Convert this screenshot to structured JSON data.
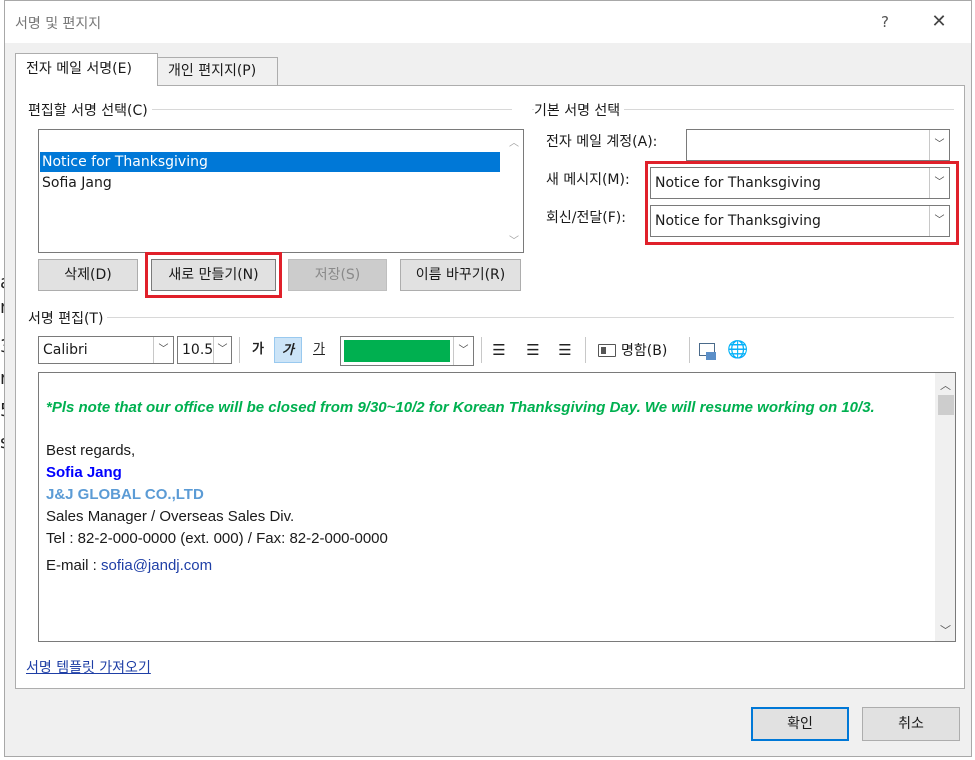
{
  "background_fragments": [
    "a",
    "n",
    "3",
    "r",
    "5",
    "s"
  ],
  "dialog": {
    "title": "서명 및 편지지",
    "help": "?",
    "close": "✕"
  },
  "tabs": [
    {
      "label": "전자 메일 서명(E)",
      "active": true
    },
    {
      "label": "개인 편지지(P)",
      "active": false
    }
  ],
  "select_section": {
    "label": "편집할 서명 선택(C)",
    "items": [
      "Notice for Thanksgiving",
      "Sofia Jang"
    ],
    "selected": 0,
    "buttons": {
      "delete": "삭제(D)",
      "new": "새로 만들기(N)",
      "save": "저장(S)",
      "rename": "이름 바꾸기(R)"
    }
  },
  "default_section": {
    "label": "기본 서명 선택",
    "account_label": "전자 메일 계정(A):",
    "account_value": "",
    "new_msg_label": "새 메시지(M):",
    "new_msg_value": "Notice for Thanksgiving",
    "reply_label": "회신/전달(F):",
    "reply_value": "Notice for Thanksgiving"
  },
  "edit_section": {
    "label": "서명 편집(T)",
    "font": "Calibri",
    "size": "10.5",
    "bold": "가",
    "italic": "가",
    "underline": "가",
    "color": "#00b050",
    "business_card": "명함(B)"
  },
  "signature": {
    "notice": "*Pls note that our office will be closed from 9/30~10/2 for Korean Thanksgiving Day. We will resume working on 10/3.",
    "regards": "Best regards,",
    "name": "Sofia Jang",
    "company": "J&J GLOBAL CO.,LTD",
    "title": "Sales Manager / Overseas Sales Div.",
    "tel": "Tel : 82-2-000-0000 (ext. 000) / Fax: 82-2-000-0000",
    "email_label": "E-mail : ",
    "email": "sofia@jandj.com",
    "colors": {
      "notice": "#00b050",
      "name": "#0000ff",
      "company": "#5b9bd5"
    }
  },
  "template_link": "서명 템플릿 가져오기",
  "footer": {
    "ok": "확인",
    "cancel": "취소"
  }
}
